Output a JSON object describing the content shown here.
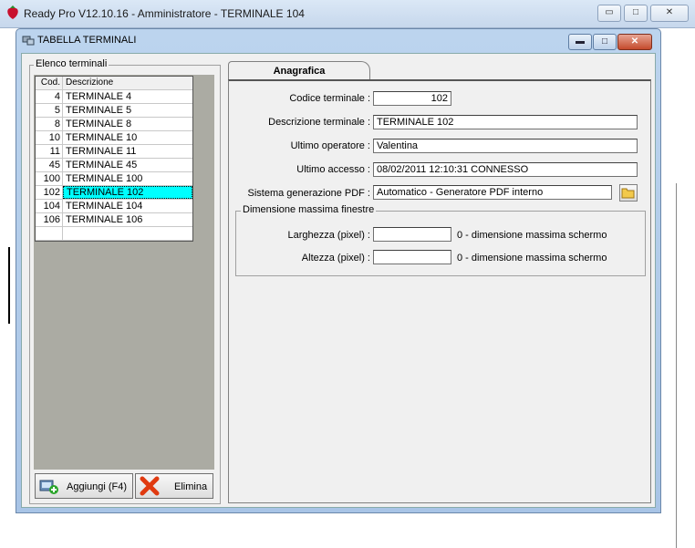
{
  "app": {
    "title": "Ready Pro V12.10.16 - Amministratore - TERMINALE 104",
    "minimize": "▭",
    "maximize": "□",
    "close": "✕"
  },
  "window": {
    "title": "TABELLA TERMINALI",
    "minimize": "▬",
    "maximize": "□",
    "close": "✕"
  },
  "list": {
    "group_label": "Elenco terminali",
    "columns": [
      "Cod.",
      "Descrizione"
    ],
    "rows": [
      {
        "cod": "4",
        "desc": "TERMINALE 4"
      },
      {
        "cod": "5",
        "desc": "TERMINALE 5"
      },
      {
        "cod": "8",
        "desc": "TERMINALE 8"
      },
      {
        "cod": "10",
        "desc": "TERMINALE 10"
      },
      {
        "cod": "11",
        "desc": "TERMINALE 11"
      },
      {
        "cod": "45",
        "desc": "TERMINALE 45"
      },
      {
        "cod": "100",
        "desc": "TERMINALE 100"
      },
      {
        "cod": "102",
        "desc": "TERMINALE 102"
      },
      {
        "cod": "104",
        "desc": "TERMINALE 104"
      },
      {
        "cod": "106",
        "desc": "TERMINALE 106"
      },
      {
        "cod": "",
        "desc": ""
      }
    ],
    "selected_row": "7",
    "selected_color": "#00ffff"
  },
  "buttons": {
    "add": "Aggiungi (F4)",
    "delete": "Elimina"
  },
  "tab": {
    "label": "Anagrafica"
  },
  "form": {
    "code_label": "Codice terminale :",
    "code_value": "102",
    "desc_label": "Descrizione terminale :",
    "desc_value": "TERMINALE 102",
    "operator_label": "Ultimo operatore :",
    "operator_value": "Valentina",
    "access_label": "Ultimo accesso :",
    "access_value": "08/02/2011  12:10:31  CONNESSO",
    "pdf_label": "Sistema generazione PDF :",
    "pdf_value": "Automatico - Generatore PDF interno"
  },
  "dimensions": {
    "group_label": "Dimensione massima finestre",
    "width_label": "Larghezza (pixel) :",
    "width_value": "",
    "width_hint": "0 - dimensione massima schermo",
    "height_label": "Altezza (pixel) :",
    "height_value": "",
    "height_hint": "0 - dimensione massima schermo"
  }
}
